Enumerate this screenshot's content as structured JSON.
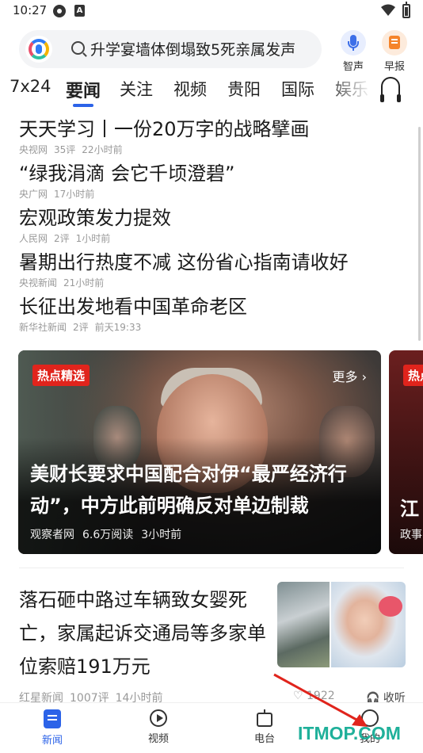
{
  "status_bar": {
    "time": "10:27",
    "notif_letter": "A"
  },
  "search": {
    "query": "升学宴墙体倒塌致5死亲属发声"
  },
  "top_actions": [
    {
      "label": "智声"
    },
    {
      "label": "早报"
    }
  ],
  "tabs": [
    "7x24",
    "要闻",
    "关注",
    "视频",
    "贵阳",
    "国际",
    "娱乐"
  ],
  "active_tab": "要闻",
  "headlines": [
    {
      "title": "天天学习丨一份20万字的战略擘画",
      "source": "央视网",
      "comments": "35评",
      "time": "22小时前"
    },
    {
      "title": "“绿我涓滴 会它千顷澄碧”",
      "source": "央广网",
      "comments": "",
      "time": "17小时前"
    },
    {
      "title": "宏观政策发力提效",
      "source": "人民网",
      "comments": "2评",
      "time": "1小时前"
    },
    {
      "title": "暑期出行热度不减 这份省心指南请收好",
      "source": "央视新闻",
      "comments": "",
      "time": "21小时前"
    },
    {
      "title": "长征出发地看中国革命老区",
      "source": "新华社新闻",
      "comments": "2评",
      "time": "前天19:33"
    }
  ],
  "hot_card": {
    "badge": "热点精选",
    "more": "更多 ›",
    "title": "美财长要求中国配合对伊“最严经济行动”，中方此前明确反对单边制裁",
    "source": "观察者网",
    "reads": "6.6万阅读",
    "time": "3小时前"
  },
  "hot_card_next": {
    "badge": "热点",
    "title_fragment": "江",
    "meta_fragment": "政事"
  },
  "article": {
    "title": "落石砸中路过车辆致女婴死亡，家属起诉交通局等多家单位索赔191万元",
    "source": "红星新闻",
    "comments": "1007评",
    "time": "14小时前",
    "likes": "1922",
    "collect": "收听"
  },
  "bottom_nav": [
    {
      "label": "新闻",
      "icon": "news-icon",
      "active": true
    },
    {
      "label": "视频",
      "icon": "play-icon",
      "active": false
    },
    {
      "label": "电台",
      "icon": "radio-icon",
      "active": false
    },
    {
      "label": "我的",
      "icon": "profile-icon",
      "active": false
    }
  ],
  "watermark": "ITMOP.COM",
  "colors": {
    "accent": "#2c63e8",
    "badge_red": "#e0241c",
    "watermark": "#1fb09a",
    "arrow": "#e0241c"
  }
}
